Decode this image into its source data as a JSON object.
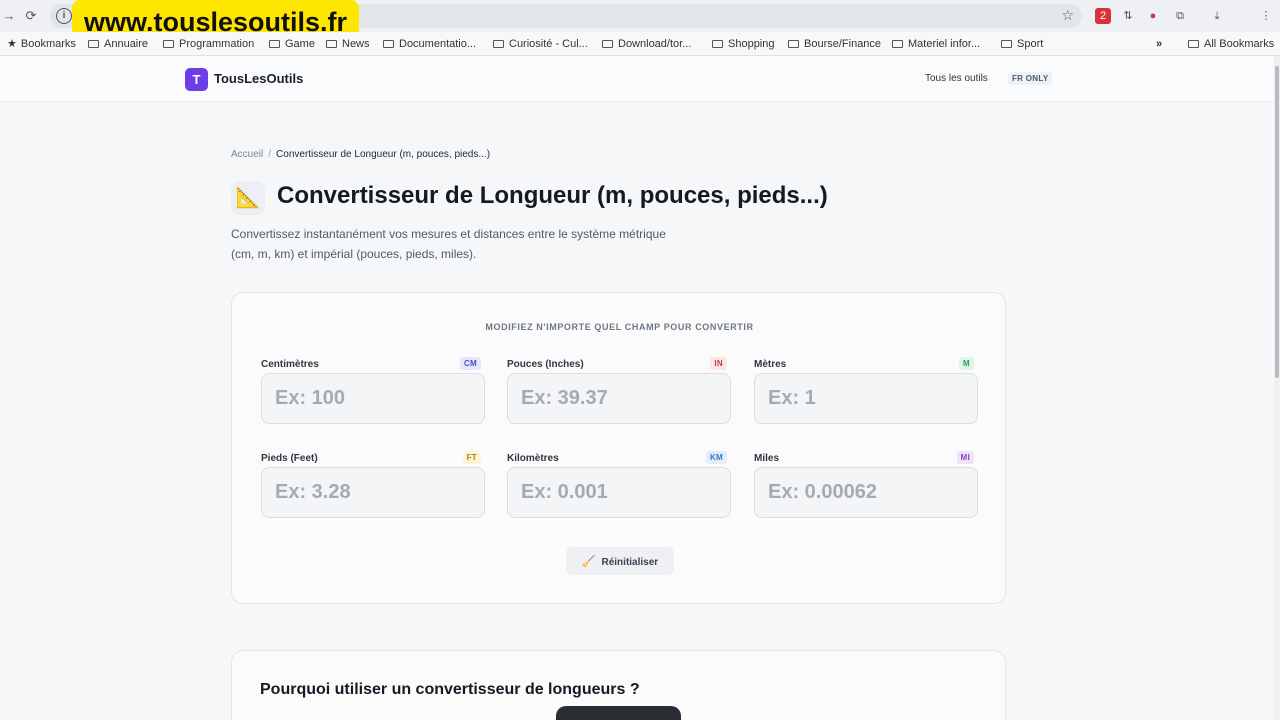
{
  "browser": {
    "url_banner": "www.touslesoutils.fr",
    "bookmarks": [
      {
        "label": "Bookmarks",
        "icon": "star-icon"
      },
      {
        "label": "Annuaire",
        "icon": "folder-icon"
      },
      {
        "label": "Programmation",
        "icon": "folder-icon"
      },
      {
        "label": "Game",
        "icon": "folder-icon"
      },
      {
        "label": "News",
        "icon": "folder-icon"
      },
      {
        "label": "Documentatio...",
        "icon": "folder-icon"
      },
      {
        "label": "Curiosité - Cul...",
        "icon": "folder-icon"
      },
      {
        "label": "Download/tor...",
        "icon": "folder-icon"
      },
      {
        "label": "Shopping",
        "icon": "folder-icon"
      },
      {
        "label": "Bourse/Finance",
        "icon": "folder-icon"
      },
      {
        "label": "Materiel infor...",
        "icon": "folder-icon"
      },
      {
        "label": "Sport",
        "icon": "folder-icon"
      }
    ],
    "more_bookmarks": "»",
    "all_bookmarks": "All Bookmarks",
    "extension_badge": "2"
  },
  "site": {
    "logo_letter": "T",
    "logo_text": "TousLesOutils",
    "nav_link": "Tous les outils",
    "lang_badge": "FR ONLY"
  },
  "breadcrumb": {
    "home": "Accueil",
    "separator": "/",
    "current": "Convertisseur de Longueur (m, pouces, pieds...)"
  },
  "page": {
    "icon": "triangle-ruler-icon",
    "icon_glyph": "📐",
    "title": "Convertisseur de Longueur (m, pouces, pieds...)",
    "description_line1": "Convertissez instantanément vos mesures et distances entre le système métrique",
    "description_line2": "(cm, m, km) et impérial (pouces, pieds, miles)."
  },
  "converter": {
    "heading": "MODIFIEZ N'IMPORTE QUEL CHAMP POUR CONVERTIR",
    "fields": [
      {
        "label": "Centimètres",
        "unit": "CM",
        "value": "",
        "placeholder": "Ex: 100",
        "badge_bg": "#e4e6fb",
        "badge_fg": "#4b4fc4"
      },
      {
        "label": "Pouces (Inches)",
        "unit": "IN",
        "value": "",
        "placeholder": "Ex: 39.37",
        "badge_bg": "#fde4e6",
        "badge_fg": "#c43a4a"
      },
      {
        "label": "Mètres",
        "unit": "M",
        "value": "",
        "placeholder": "Ex: 1",
        "badge_bg": "#dff5e6",
        "badge_fg": "#2f9a56"
      },
      {
        "label": "Pieds (Feet)",
        "unit": "FT",
        "value": "",
        "placeholder": "Ex: 3.28",
        "badge_bg": "#fbf3d2",
        "badge_fg": "#a88511"
      },
      {
        "label": "Kilomètres",
        "unit": "KM",
        "value": "",
        "placeholder": "Ex: 0.001",
        "badge_bg": "#e0eefa",
        "badge_fg": "#3a78b8"
      },
      {
        "label": "Miles",
        "unit": "MI",
        "value": "",
        "placeholder": "Ex: 0.00062",
        "badge_bg": "#f0e2fa",
        "badge_fg": "#8b42b8"
      }
    ],
    "reset_icon": "broom-icon",
    "reset_glyph": "🧹",
    "reset_label": "Réinitialiser"
  },
  "section2": {
    "title": "Pourquoi utiliser un convertisseur de longueurs ?"
  },
  "colors": {
    "brand": "#6d3ee8",
    "banner": "#ffe600"
  }
}
